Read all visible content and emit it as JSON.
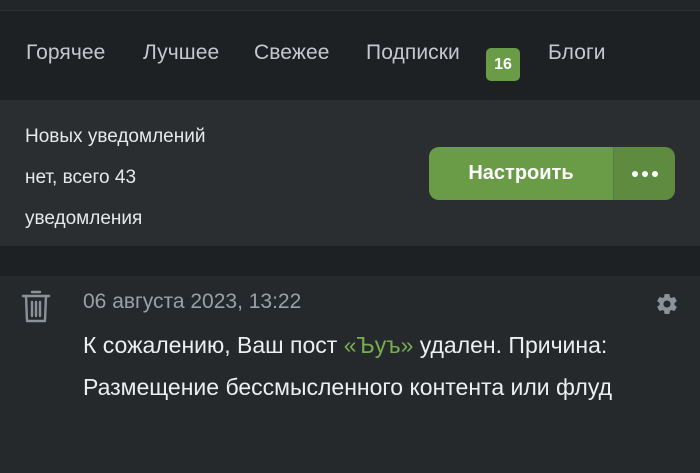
{
  "nav": {
    "tabs": [
      {
        "label": "Горячее"
      },
      {
        "label": "Лучшее"
      },
      {
        "label": "Свежее"
      },
      {
        "label": "Подписки"
      },
      {
        "label": "Блоги"
      }
    ],
    "subscriptions_badge": "16"
  },
  "notifications_panel": {
    "line1": "Новых уведомлений",
    "line2": "нет, всего 43",
    "line3": "уведомления",
    "setup_label": "Настроить",
    "more_icon": "ellipsis-icon"
  },
  "notification_item": {
    "icon": "trash-icon",
    "date": "06 августа 2023, 13:22",
    "settings_icon": "gear-icon",
    "message_prefix": "К сожалению, Ваш пост ",
    "post_link": "«Ъуъ»",
    "message_suffix": " удален. Причина: Размещение бессмысленного контента или флуд"
  },
  "colors": {
    "background": "#1e2124",
    "panel": "#2a2e31",
    "accent_green": "#6a9c48",
    "link_green": "#77ad52"
  }
}
